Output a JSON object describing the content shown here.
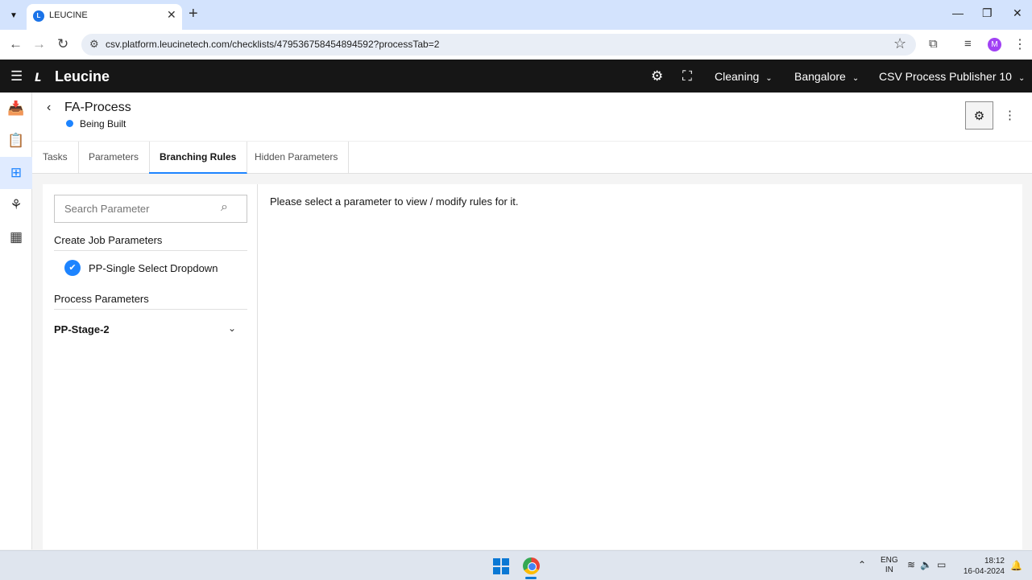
{
  "browser": {
    "tab_title": "LEUCINE",
    "url": "csv.platform.leucinetech.com/checklists/479536758454894592?processTab=2",
    "profile_initial": "M"
  },
  "appbar": {
    "logo_text": "Leucine",
    "facility_select": "Cleaning",
    "location_select": "Bangalore",
    "user_select": "CSV Process Publisher 10"
  },
  "process": {
    "name": "FA-Process",
    "status": "Being Built"
  },
  "tabs": [
    {
      "label": "Tasks"
    },
    {
      "label": "Parameters"
    },
    {
      "label": "Branching Rules"
    },
    {
      "label": "Hidden Parameters"
    }
  ],
  "sidebar": {
    "search_placeholder": "Search Parameter",
    "create_job_title": "Create Job Parameters",
    "create_job_items": [
      {
        "label": "PP-Single Select Dropdown"
      }
    ],
    "process_params_title": "Process Parameters",
    "stages": [
      {
        "label": "PP-Stage-2"
      }
    ]
  },
  "main": {
    "empty_message": "Please select a parameter to view / modify rules for it."
  },
  "taskbar": {
    "lang_line1": "ENG",
    "lang_line2": "IN",
    "time": "18:12",
    "date": "16-04-2024"
  },
  "colors": {
    "accent": "#1d84ff",
    "header_bg": "#161616"
  }
}
